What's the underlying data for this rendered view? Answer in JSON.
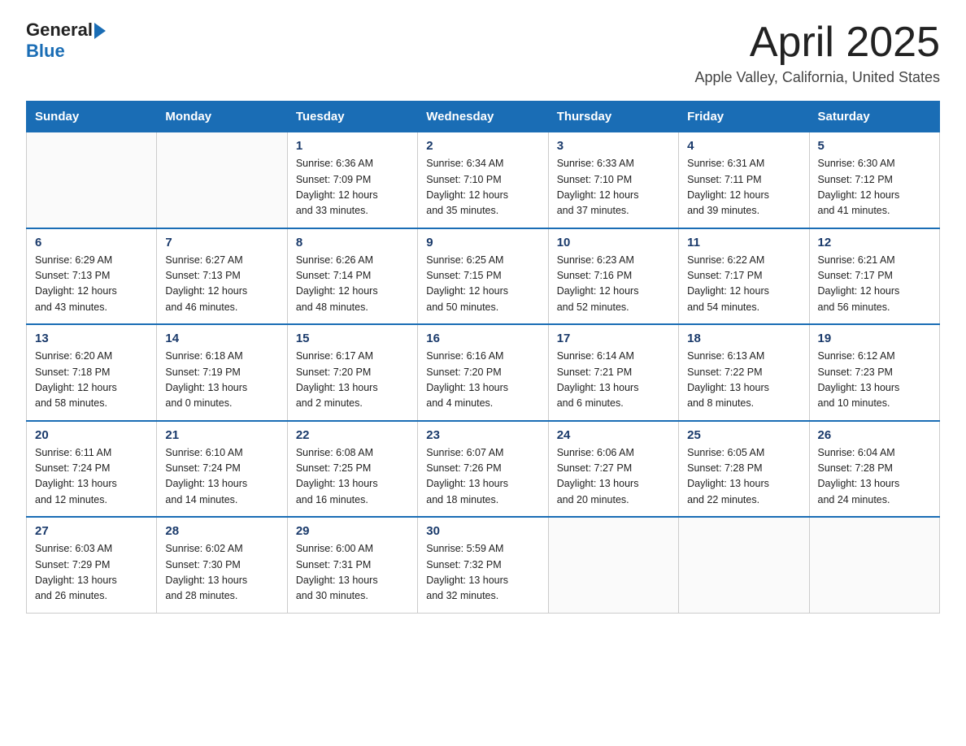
{
  "header": {
    "logo_general": "General",
    "logo_blue": "Blue",
    "title": "April 2025",
    "subtitle": "Apple Valley, California, United States"
  },
  "weekdays": [
    "Sunday",
    "Monday",
    "Tuesday",
    "Wednesday",
    "Thursday",
    "Friday",
    "Saturday"
  ],
  "weeks": [
    [
      {
        "day": "",
        "info": ""
      },
      {
        "day": "",
        "info": ""
      },
      {
        "day": "1",
        "info": "Sunrise: 6:36 AM\nSunset: 7:09 PM\nDaylight: 12 hours\nand 33 minutes."
      },
      {
        "day": "2",
        "info": "Sunrise: 6:34 AM\nSunset: 7:10 PM\nDaylight: 12 hours\nand 35 minutes."
      },
      {
        "day": "3",
        "info": "Sunrise: 6:33 AM\nSunset: 7:10 PM\nDaylight: 12 hours\nand 37 minutes."
      },
      {
        "day": "4",
        "info": "Sunrise: 6:31 AM\nSunset: 7:11 PM\nDaylight: 12 hours\nand 39 minutes."
      },
      {
        "day": "5",
        "info": "Sunrise: 6:30 AM\nSunset: 7:12 PM\nDaylight: 12 hours\nand 41 minutes."
      }
    ],
    [
      {
        "day": "6",
        "info": "Sunrise: 6:29 AM\nSunset: 7:13 PM\nDaylight: 12 hours\nand 43 minutes."
      },
      {
        "day": "7",
        "info": "Sunrise: 6:27 AM\nSunset: 7:13 PM\nDaylight: 12 hours\nand 46 minutes."
      },
      {
        "day": "8",
        "info": "Sunrise: 6:26 AM\nSunset: 7:14 PM\nDaylight: 12 hours\nand 48 minutes."
      },
      {
        "day": "9",
        "info": "Sunrise: 6:25 AM\nSunset: 7:15 PM\nDaylight: 12 hours\nand 50 minutes."
      },
      {
        "day": "10",
        "info": "Sunrise: 6:23 AM\nSunset: 7:16 PM\nDaylight: 12 hours\nand 52 minutes."
      },
      {
        "day": "11",
        "info": "Sunrise: 6:22 AM\nSunset: 7:17 PM\nDaylight: 12 hours\nand 54 minutes."
      },
      {
        "day": "12",
        "info": "Sunrise: 6:21 AM\nSunset: 7:17 PM\nDaylight: 12 hours\nand 56 minutes."
      }
    ],
    [
      {
        "day": "13",
        "info": "Sunrise: 6:20 AM\nSunset: 7:18 PM\nDaylight: 12 hours\nand 58 minutes."
      },
      {
        "day": "14",
        "info": "Sunrise: 6:18 AM\nSunset: 7:19 PM\nDaylight: 13 hours\nand 0 minutes."
      },
      {
        "day": "15",
        "info": "Sunrise: 6:17 AM\nSunset: 7:20 PM\nDaylight: 13 hours\nand 2 minutes."
      },
      {
        "day": "16",
        "info": "Sunrise: 6:16 AM\nSunset: 7:20 PM\nDaylight: 13 hours\nand 4 minutes."
      },
      {
        "day": "17",
        "info": "Sunrise: 6:14 AM\nSunset: 7:21 PM\nDaylight: 13 hours\nand 6 minutes."
      },
      {
        "day": "18",
        "info": "Sunrise: 6:13 AM\nSunset: 7:22 PM\nDaylight: 13 hours\nand 8 minutes."
      },
      {
        "day": "19",
        "info": "Sunrise: 6:12 AM\nSunset: 7:23 PM\nDaylight: 13 hours\nand 10 minutes."
      }
    ],
    [
      {
        "day": "20",
        "info": "Sunrise: 6:11 AM\nSunset: 7:24 PM\nDaylight: 13 hours\nand 12 minutes."
      },
      {
        "day": "21",
        "info": "Sunrise: 6:10 AM\nSunset: 7:24 PM\nDaylight: 13 hours\nand 14 minutes."
      },
      {
        "day": "22",
        "info": "Sunrise: 6:08 AM\nSunset: 7:25 PM\nDaylight: 13 hours\nand 16 minutes."
      },
      {
        "day": "23",
        "info": "Sunrise: 6:07 AM\nSunset: 7:26 PM\nDaylight: 13 hours\nand 18 minutes."
      },
      {
        "day": "24",
        "info": "Sunrise: 6:06 AM\nSunset: 7:27 PM\nDaylight: 13 hours\nand 20 minutes."
      },
      {
        "day": "25",
        "info": "Sunrise: 6:05 AM\nSunset: 7:28 PM\nDaylight: 13 hours\nand 22 minutes."
      },
      {
        "day": "26",
        "info": "Sunrise: 6:04 AM\nSunset: 7:28 PM\nDaylight: 13 hours\nand 24 minutes."
      }
    ],
    [
      {
        "day": "27",
        "info": "Sunrise: 6:03 AM\nSunset: 7:29 PM\nDaylight: 13 hours\nand 26 minutes."
      },
      {
        "day": "28",
        "info": "Sunrise: 6:02 AM\nSunset: 7:30 PM\nDaylight: 13 hours\nand 28 minutes."
      },
      {
        "day": "29",
        "info": "Sunrise: 6:00 AM\nSunset: 7:31 PM\nDaylight: 13 hours\nand 30 minutes."
      },
      {
        "day": "30",
        "info": "Sunrise: 5:59 AM\nSunset: 7:32 PM\nDaylight: 13 hours\nand 32 minutes."
      },
      {
        "day": "",
        "info": ""
      },
      {
        "day": "",
        "info": ""
      },
      {
        "day": "",
        "info": ""
      }
    ]
  ]
}
